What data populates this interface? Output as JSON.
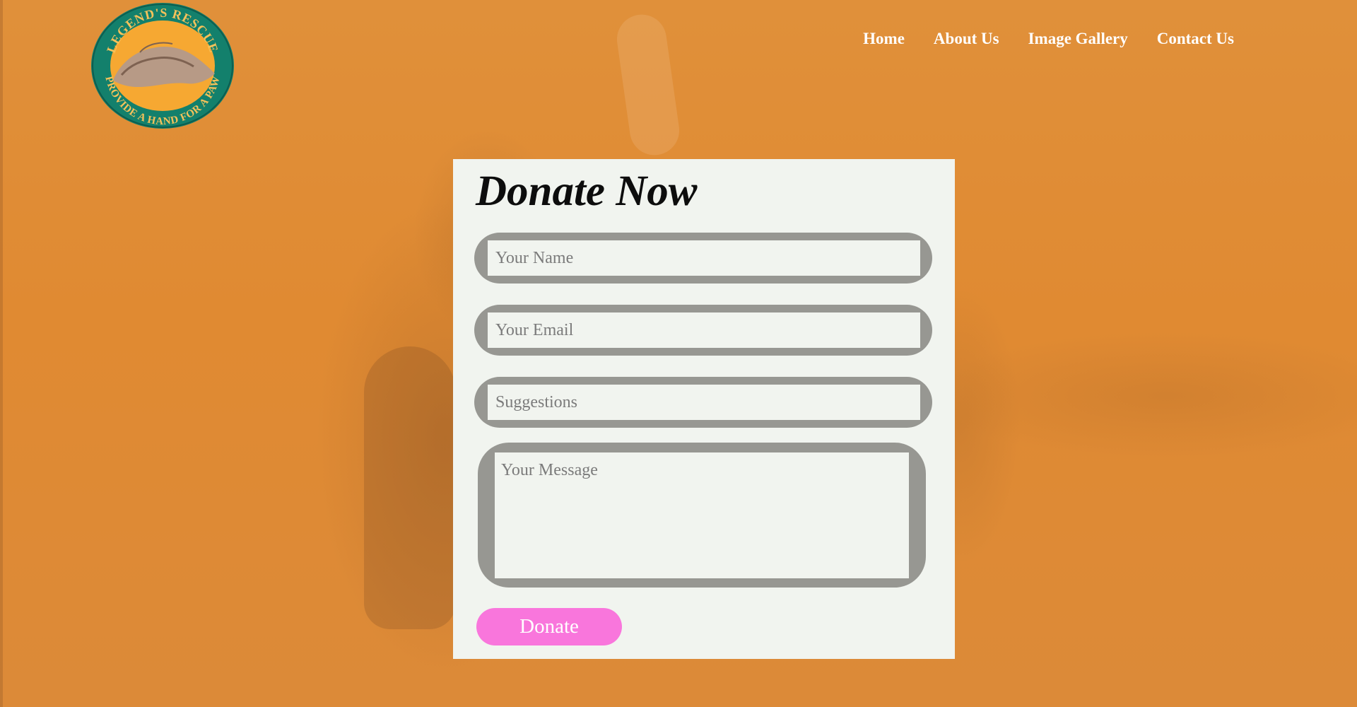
{
  "logo": {
    "top_text": "LEGEND'S RESCUE",
    "bottom_text": "PROVIDE A HAND FOR A PAW",
    "colors": {
      "ring": "#13806c",
      "center": "#f6a832",
      "text": "#f6c25a"
    }
  },
  "nav": {
    "items": [
      "Home",
      "About Us",
      "Image Gallery",
      "Contact Us"
    ]
  },
  "form": {
    "title": "Donate Now",
    "name_placeholder": "Your Name",
    "email_placeholder": "Your Email",
    "suggestions_placeholder": "Suggestions",
    "message_placeholder": "Your Message",
    "submit_label": "Donate"
  },
  "colors": {
    "background": "#e38d32",
    "card": "#f1f4ef",
    "field_border": "#979792",
    "button": "#f976dc"
  }
}
